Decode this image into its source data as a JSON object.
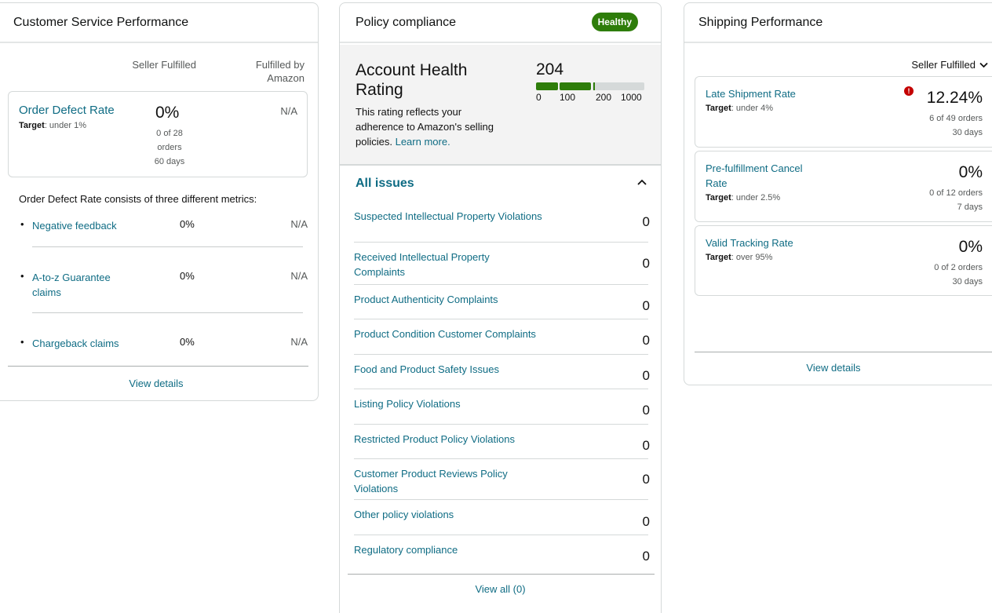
{
  "customer_service": {
    "title": "Customer Service Performance",
    "col_seller": "Seller Fulfilled",
    "col_fba_line1": "Fulfilled by",
    "col_fba_line2": "Amazon",
    "odr": {
      "title": "Order Defect Rate",
      "target_label": "Target",
      "target_value": ": under 1%",
      "value": "0%",
      "count_line1": "0 of 28",
      "count_line2": "orders",
      "period": "60 days",
      "fba_value": "N/A"
    },
    "description": "Order Defect Rate consists of three different metrics:",
    "metrics": [
      {
        "name": "Negative feedback",
        "value": "0%",
        "fba": "N/A"
      },
      {
        "name": "A-to-z Guarantee claims",
        "value": "0%",
        "fba": "N/A"
      },
      {
        "name": "Chargeback claims",
        "value": "0%",
        "fba": "N/A"
      }
    ],
    "view_details": "View details"
  },
  "policy": {
    "title": "Policy compliance",
    "badge": "Healthy",
    "ahr_title": "Account Health Rating",
    "ahr_desc": "This rating reflects your adherence to Amazon's selling policies.",
    "learn_more": "Learn more.",
    "score": "204",
    "score_value": 204,
    "gauge_labels": [
      "0",
      "100",
      "200",
      "1000"
    ],
    "gauge_colors": {
      "filled": "#2e7d0a",
      "empty": "#d5d9d9"
    },
    "issues_title": "All issues",
    "issues": [
      {
        "name": "Suspected Intellectual Property Violations",
        "count": "0"
      },
      {
        "name": "Received Intellectual Property Complaints",
        "count": "0"
      },
      {
        "name": "Product Authenticity Complaints",
        "count": "0"
      },
      {
        "name": "Product Condition Customer Complaints",
        "count": "0"
      },
      {
        "name": "Food and Product Safety Issues",
        "count": "0"
      },
      {
        "name": "Listing Policy Violations",
        "count": "0"
      },
      {
        "name": "Restricted Product Policy Violations",
        "count": "0"
      },
      {
        "name": "Customer Product Reviews Policy Violations",
        "count": "0"
      },
      {
        "name": "Other policy violations",
        "count": "0"
      },
      {
        "name": "Regulatory compliance",
        "count": "0"
      }
    ],
    "view_all": "View all (0)"
  },
  "shipping": {
    "title": "Shipping Performance",
    "filter": "Seller Fulfilled",
    "metrics": [
      {
        "name": "Late Shipment Rate",
        "target_label": "Target",
        "target_value": ": under 4%",
        "value": "12.24%",
        "count": "6 of 49 orders",
        "period": "30 days",
        "alert": "!"
      },
      {
        "name": "Pre-fulfillment Cancel Rate",
        "target_label": "Target",
        "target_value": ": under 2.5%",
        "value": "0%",
        "count": "0 of 12 orders",
        "period": "7 days"
      },
      {
        "name": "Valid Tracking Rate",
        "target_label": "Target",
        "target_value": ": over 95%",
        "value": "0%",
        "count": "0 of 2 orders",
        "period": "30 days"
      }
    ],
    "view_details": "View details"
  }
}
